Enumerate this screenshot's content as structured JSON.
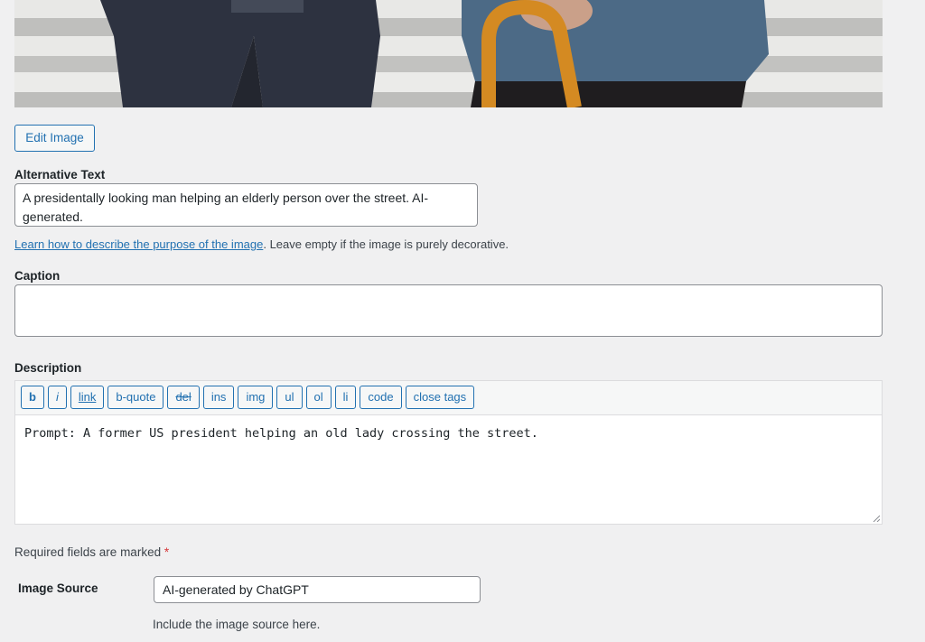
{
  "media": {
    "edit_image_label": "Edit Image",
    "alt_text": {
      "label": "Alternative Text",
      "value": "A presidentally looking man helping an elderly person over the street. AI-generated.",
      "help_link": "Learn how to describe the purpose of the image",
      "help_rest": ". Leave empty if the image is purely decorative."
    },
    "caption": {
      "label": "Caption",
      "value": ""
    },
    "description": {
      "label": "Description",
      "value": "Prompt: A former US president helping an old lady crossing the street.",
      "toolbar": [
        "b",
        "i",
        "link",
        "b-quote",
        "del",
        "ins",
        "img",
        "ul",
        "ol",
        "li",
        "code",
        "close tags"
      ]
    },
    "required_note": "Required fields are marked",
    "required_star": "*",
    "image_source": {
      "label": "Image Source",
      "value": "AI-generated by ChatGPT",
      "help": "Include the image source here."
    }
  },
  "colors": {
    "accent": "#2271b1",
    "background": "#f0f0f1",
    "required": "#d63638"
  }
}
